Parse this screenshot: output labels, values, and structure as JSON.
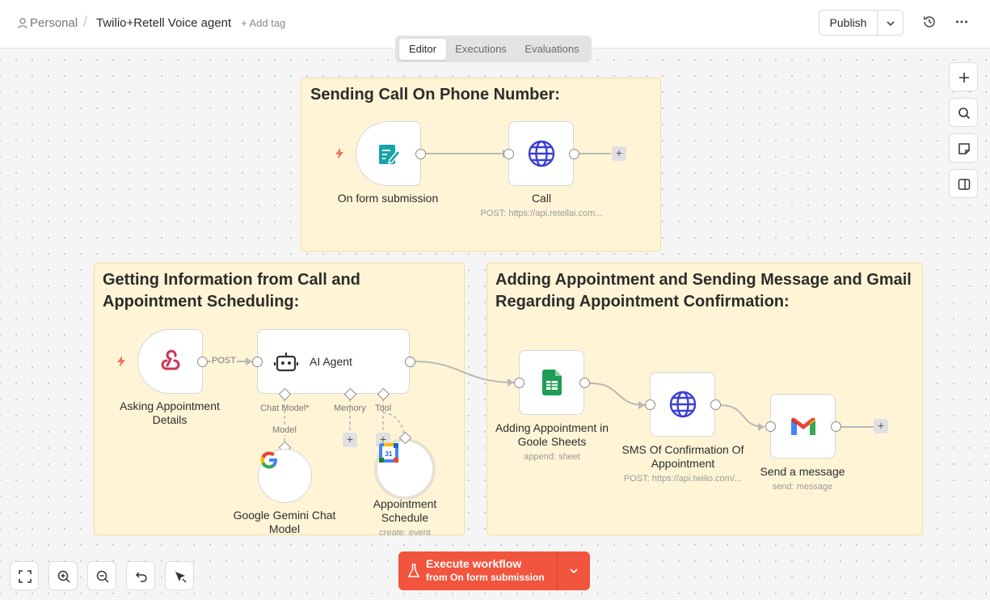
{
  "header": {
    "workspace": "Personal",
    "workflow_name": "Twilio+Retell Voice agent",
    "add_tag": "+ Add tag",
    "publish_label": "Publish"
  },
  "tabs": [
    {
      "label": "Editor",
      "active": true
    },
    {
      "label": "Executions",
      "active": false
    },
    {
      "label": "Evaluations",
      "active": false
    }
  ],
  "stickies": {
    "sending_call": "Sending Call On Phone Number:",
    "getting_info_line1": "Getting Information from Call and",
    "getting_info_line2": "Appointment Scheduling:",
    "adding_line1": "Adding Appointment and Sending Message and Gmail",
    "adding_line2": "Regarding Appointment Confirmation:"
  },
  "nodes": {
    "form": {
      "label": "On form submission"
    },
    "call": {
      "label": "Call",
      "sub": "POST: https://api.retellai.com..."
    },
    "webhook": {
      "label_line1": "Asking Appointment",
      "label_line2": "Details",
      "method": "POST"
    },
    "agent": {
      "label": "AI Agent",
      "chat_model": "Chat Model",
      "required_mark": "*",
      "memory": "Memory",
      "tool": "Tool"
    },
    "gemini": {
      "label_line1": "Google Gemini Chat",
      "label_line2": "Model",
      "port_label": "Model"
    },
    "calendar": {
      "label_line1": "Appointment",
      "label_line2": "Schedule",
      "sub": "create: event",
      "day": "31"
    },
    "sheets": {
      "label_line1": "Adding Appointment in",
      "label_line2": "Goole Sheets",
      "sub": "append: sheet"
    },
    "sms": {
      "label_line1": "SMS Of Confirmation Of",
      "label_line2": "Appointment",
      "sub": "POST: https://api.twilio.com/..."
    },
    "gmail": {
      "label": "Send a message",
      "sub": "send: message"
    }
  },
  "execute": {
    "label": "Execute workflow",
    "sub": "from On form submission"
  },
  "colors": {
    "accent": "#f1553d",
    "sticky_bg": "#fff5d6",
    "globe": "#3b3fd6",
    "form_teal": "#16a4a8",
    "sheets_green": "#1e9e55",
    "trigger_bolt": "#f4705f"
  },
  "icons": [
    "person-icon",
    "history-icon",
    "more-icon",
    "plus-icon",
    "search-icon",
    "sticky-note-icon",
    "panel-icon",
    "form-icon",
    "globe-icon",
    "webhook-icon",
    "robot-icon",
    "google-icon",
    "calendar-icon",
    "sheets-icon",
    "gmail-icon",
    "flask-icon",
    "fit-view-icon",
    "zoom-in-icon",
    "zoom-out-icon",
    "undo-icon",
    "clean-up-icon"
  ]
}
